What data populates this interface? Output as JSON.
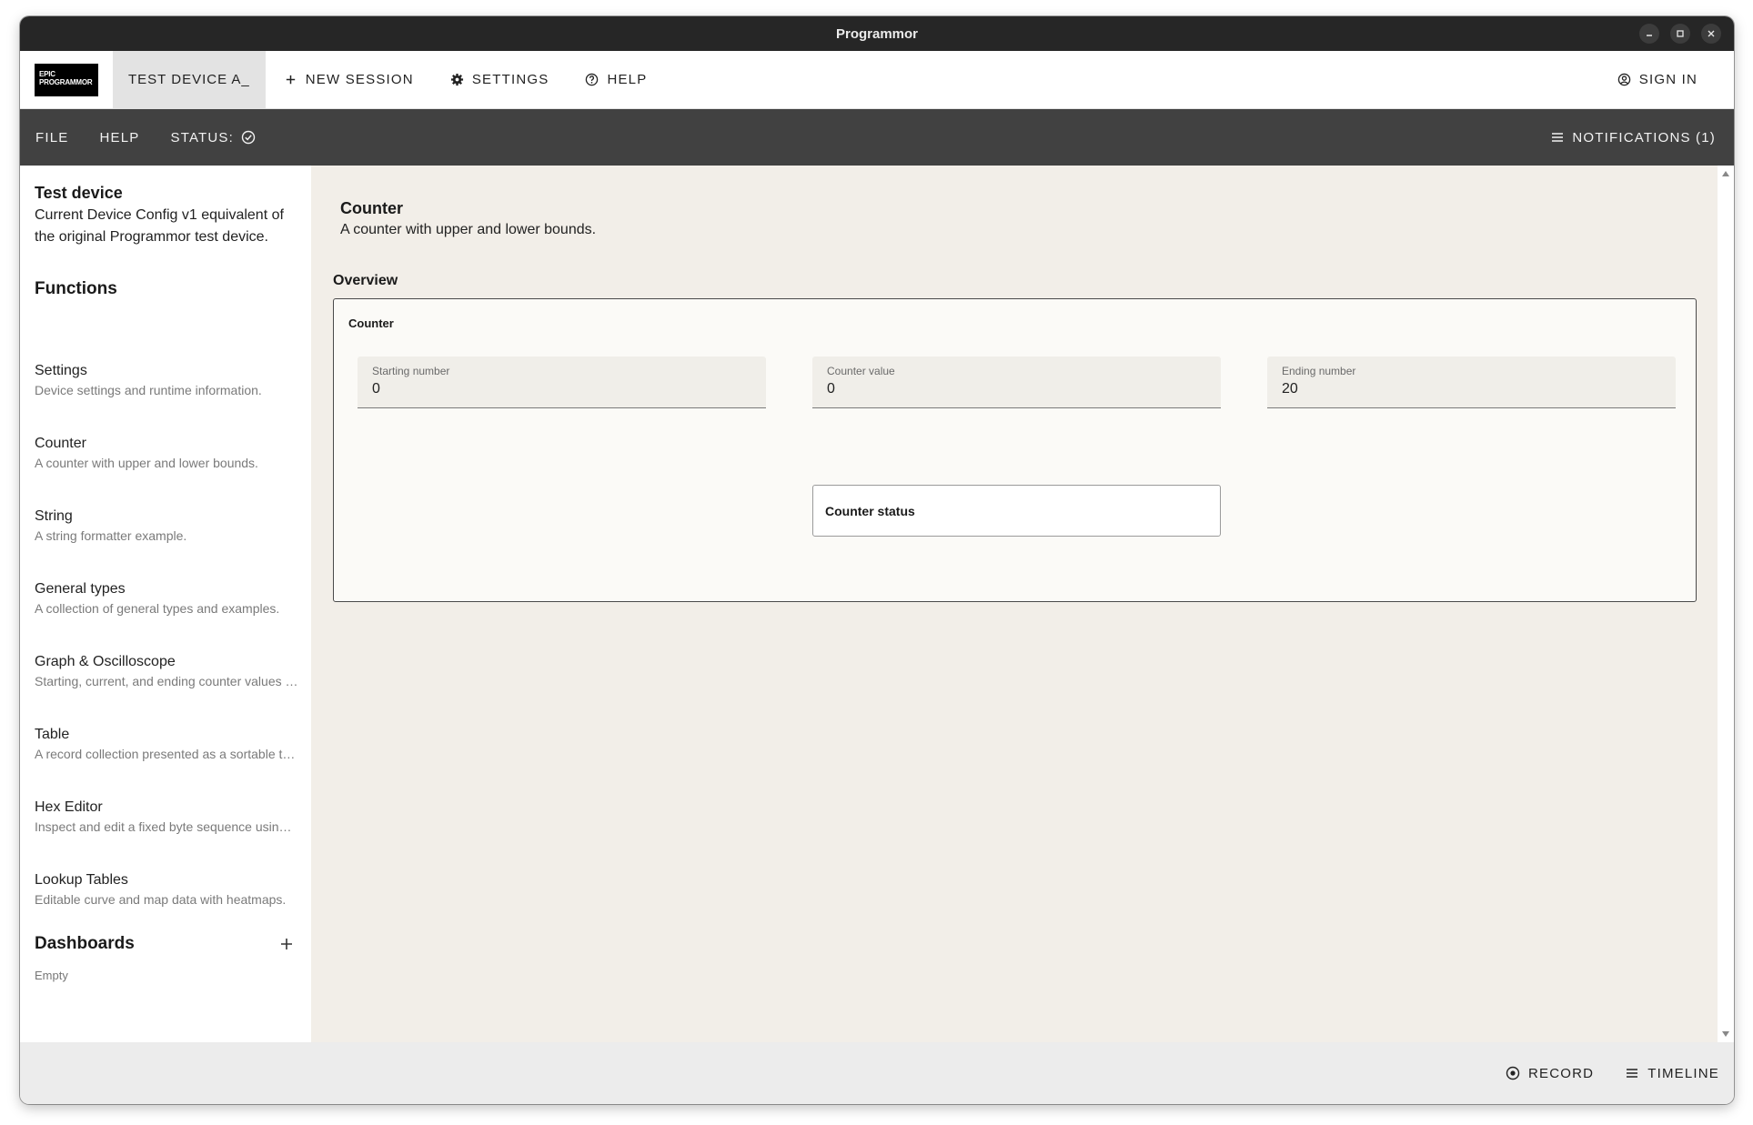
{
  "window": {
    "title": "Programmor"
  },
  "appbar": {
    "logo_line1": "EPIC",
    "logo_line2": "PROGRAMMOR",
    "device_tab": "TEST DEVICE A_",
    "new_session": "NEW SESSION",
    "settings": "SETTINGS",
    "help": "HELP",
    "sign_in": "SIGN IN"
  },
  "toolbar": {
    "file": "FILE",
    "help": "HELP",
    "status_label": "STATUS:",
    "notifications": "NOTIFICATIONS (1)"
  },
  "sidebar": {
    "device_title": "Test device",
    "device_desc": "Current Device Config v1 equivalent of the original Programmor test device.",
    "functions_heading": "Functions",
    "items": [
      {
        "name": "Settings",
        "desc": "Device settings and runtime information."
      },
      {
        "name": "Counter",
        "desc": "A counter with upper and lower bounds."
      },
      {
        "name": "String",
        "desc": "A string formatter example."
      },
      {
        "name": "General types",
        "desc": "A collection of general types and examples."
      },
      {
        "name": "Graph & Oscilloscope",
        "desc": "Starting, current, and ending counter values plotted."
      },
      {
        "name": "Table",
        "desc": "A record collection presented as a sortable table."
      },
      {
        "name": "Hex Editor",
        "desc": "Inspect and edit a fixed byte sequence using hex."
      },
      {
        "name": "Lookup Tables",
        "desc": "Editable curve and map data with heatmaps."
      }
    ],
    "dashboards_heading": "Dashboards",
    "dashboards_empty": "Empty"
  },
  "main": {
    "title": "Counter",
    "desc": "A counter with upper and lower bounds.",
    "overview": "Overview",
    "panel_title": "Counter",
    "fields": [
      {
        "label": "Starting number",
        "value": "0"
      },
      {
        "label": "Counter value",
        "value": "0"
      },
      {
        "label": "Ending number",
        "value": "20"
      }
    ],
    "status_box": "Counter status"
  },
  "bottombar": {
    "record": "RECORD",
    "timeline": "TIMELINE"
  }
}
